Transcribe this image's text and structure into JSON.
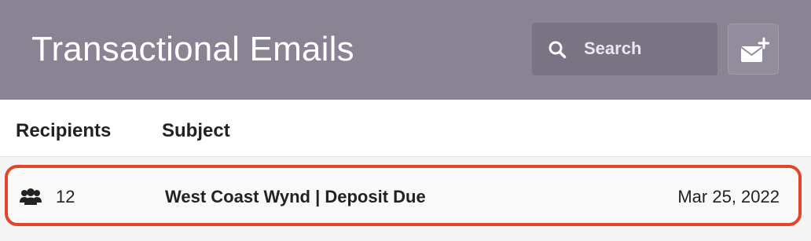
{
  "header": {
    "title": "Transactional Emails",
    "search": {
      "placeholder": "Search",
      "value": ""
    },
    "compose_icon": "envelope-plus-icon",
    "search_icon": "search-icon"
  },
  "table": {
    "columns": [
      "Recipients",
      "Subject"
    ],
    "rows": [
      {
        "recipients_icon": "users-icon",
        "recipients": "12",
        "subject": "West Coast Wynd | Deposit Due",
        "date": "Mar 25, 2022"
      }
    ]
  },
  "colors": {
    "header_background": "#8a8393",
    "highlight_border": "#e2452b",
    "text": "#222222"
  }
}
